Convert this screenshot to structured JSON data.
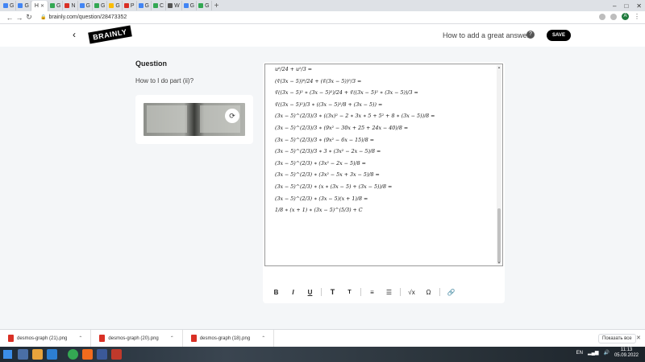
{
  "browser": {
    "tabs": [
      {
        "label": "G",
        "color": "#4285f4"
      },
      {
        "label": "G",
        "color": "#4285f4"
      },
      {
        "label": "G",
        "color": "#34a853"
      },
      {
        "label": "N",
        "color": "#d93025"
      },
      {
        "label": "G",
        "color": "#4285f4"
      },
      {
        "label": "G",
        "color": "#34a853"
      },
      {
        "label": "G",
        "color": "#fbbc04"
      },
      {
        "label": "Р",
        "color": "#d93025"
      },
      {
        "label": "G",
        "color": "#4285f4"
      },
      {
        "label": "C",
        "color": "#34a853"
      },
      {
        "label": "W",
        "color": "#555555"
      },
      {
        "label": "G",
        "color": "#4285f4"
      },
      {
        "label": "G",
        "color": "#34a853"
      }
    ],
    "active_tab": {
      "label": "Н"
    },
    "new_tab_label": "+",
    "url": "brainly.com/question/28473352"
  },
  "header": {
    "back_label": "‹",
    "logo_text": "BRAINLY",
    "howto_text": "How to add a great answer",
    "help_label": "?",
    "save_label": "SAVE"
  },
  "question": {
    "heading": "Question",
    "text": "How to I do part (ii)?",
    "rotate_icon": "rotate-icon"
  },
  "editor": {
    "math_lines": [
      "u⁸/24 + u⁵/3 =",
      "(∛(3x − 5))⁸/24 + (∛(3x − 5))⁵/3 =",
      "∛((3x − 5)² ∗ (3x − 5)²)/24 + ∛((3x − 5)² ∗ (3x − 5))/3 =",
      "∛((3x − 5)²)/3 ∗ ((3x − 5)²/8 + (3x − 5)) =",
      "(3x − 5)^(2/3)/3 ∗ ((3x)² − 2 ∗ 3x ∗ 5 + 5² + 8 ∗ (3x − 5))/8 =",
      "(3x − 5)^(2/3)/3 ∗ (9x² − 30x + 25 + 24x − 40)/8 =",
      "(3x − 5)^(2/3)/3 ∗ (9x² − 6x − 15)/8 =",
      "(3x − 5)^(2/3)/3 ∗ 3 ∗ (3x² − 2x − 5)/8 =",
      "(3x − 5)^(2/3) ∗ (3x² − 2x − 5)/8 =",
      "(3x − 5)^(2/3) ∗ (3x² − 5x + 3x − 5)/8 =",
      "(3x − 5)^(2/3) ∗ (x ∗ (3x − 5) + (3x − 5))/8 =",
      "(3x − 5)^(2/3) ∗ (3x − 5)(x + 1)/8 =",
      "1/8 ∗ (x + 1) ∗ (3x − 5)^(5/3) + C"
    ],
    "toolbar": {
      "bold": "B",
      "italic": "I",
      "underline": "U",
      "text_large": "T",
      "text_small": "T",
      "ordered_list": "≡",
      "bullet_list": "☰",
      "equation": "√x",
      "symbol": "Ω",
      "attach": "🔗"
    }
  },
  "downloads": {
    "items": [
      {
        "name": "desmos-graph (21).png"
      },
      {
        "name": "desmos-graph (20).png"
      },
      {
        "name": "desmos-graph (18).png"
      }
    ],
    "show_all": "Показать все",
    "close": "✕"
  },
  "taskbar": {
    "lang": "EN",
    "time": "11:13",
    "date": "05.09.2022"
  }
}
